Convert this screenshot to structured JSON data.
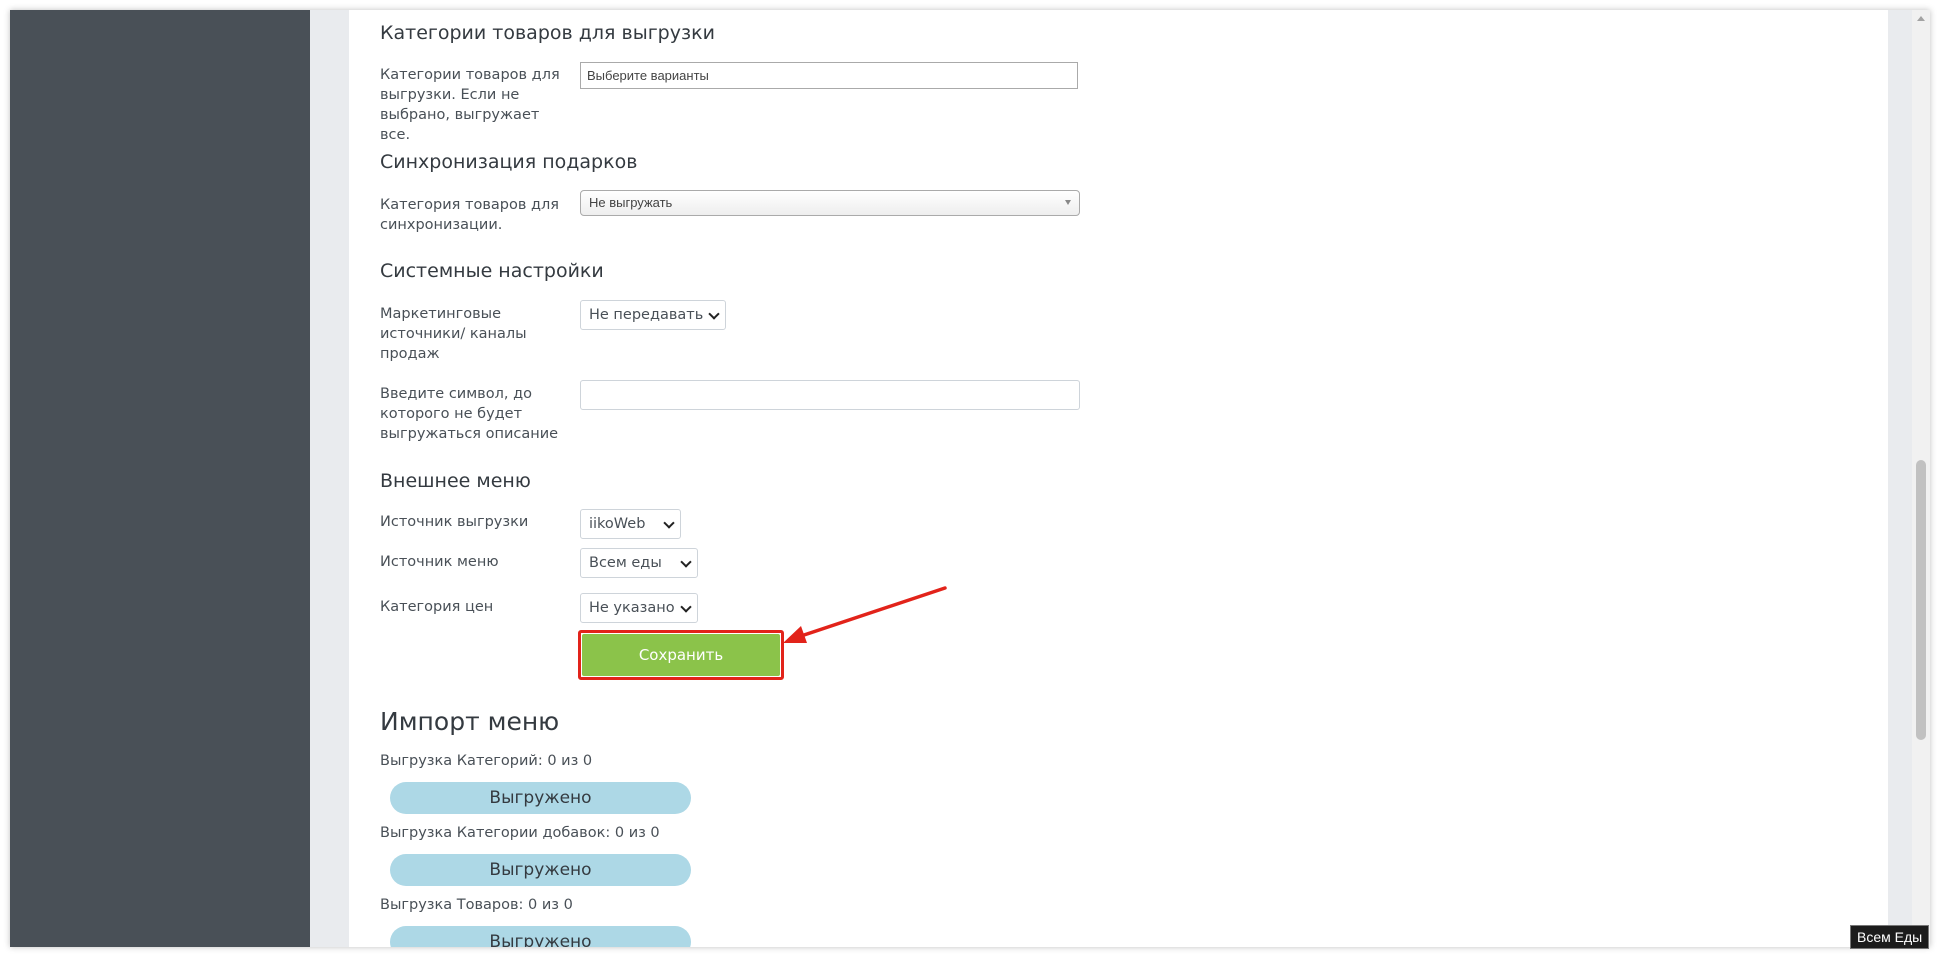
{
  "sections": {
    "categories": {
      "title": "Категории товаров для выгрузки",
      "label": "Категории товаров для выгрузки. Если не выбрано, выгружает все.",
      "placeholder": "Выберите варианты"
    },
    "gifts": {
      "title": "Синхронизация подарков",
      "label": "Категория товаров для синхронизации.",
      "value": "Не выгружать"
    },
    "system": {
      "title": "Системные настройки",
      "marketing_label": "Маркетинговые источники/ каналы продаж",
      "marketing_value": "Не передавать",
      "symbol_label": "Введите символ, до которого не будет выгружаться описание",
      "symbol_value": ""
    },
    "external_menu": {
      "title": "Внешнее меню",
      "source_label": "Источник выгрузки",
      "source_value": "iikoWeb",
      "menu_label": "Источник меню",
      "menu_value": "Всем еды",
      "price_label": "Категория цен",
      "price_value": "Не указано"
    }
  },
  "save_button": "Сохранить",
  "import": {
    "title": "Импорт меню",
    "rows": [
      {
        "label": "Выгрузка Категорий: 0 из 0",
        "status": "Выгружено",
        "progress": 1
      },
      {
        "label": "Выгрузка Категории добавок: 0 из 0",
        "status": "Выгружено",
        "progress": 1
      },
      {
        "label": "Выгрузка Товаров: 0 из 0",
        "status": "Выгружено",
        "progress": 1
      }
    ]
  },
  "tooltip": "Всем Еды",
  "colors": {
    "sidebar": "#495057",
    "save_button": "#8bc34a",
    "highlight": "#e2231a",
    "progress_pill": "#add8e6"
  }
}
